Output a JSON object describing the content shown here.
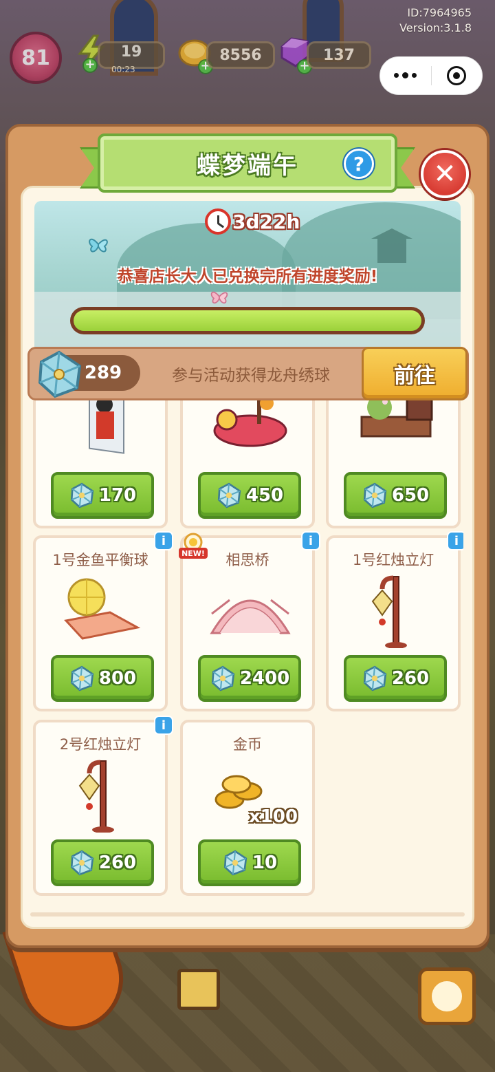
{
  "hud": {
    "user_id": "ID:7964965",
    "version": "Version:3.1.8",
    "level": "81",
    "energy": "19",
    "energy_timer": "00:23",
    "coins": "8556",
    "gems": "137"
  },
  "panel": {
    "title": "蝶梦端午",
    "help": "?",
    "close": "✕"
  },
  "banner": {
    "countdown": "3d22h",
    "message": "恭喜店长大人已兑换完所有进度奖励!",
    "progress": 1.0
  },
  "currency": {
    "count": "289",
    "hint": "参与活动获得龙舟绣球",
    "go_label": "前往"
  },
  "items": [
    {
      "name": "",
      "price": "170",
      "info": false,
      "new": false
    },
    {
      "name": "",
      "price": "450",
      "info": false,
      "new": false
    },
    {
      "name": "",
      "price": "650",
      "info": false,
      "new": false
    },
    {
      "name": "1号金鱼平衡球",
      "price": "800",
      "info": true,
      "new": false
    },
    {
      "name": "相思桥",
      "price": "2400",
      "info": true,
      "new": true
    },
    {
      "name": "1号红烛立灯",
      "price": "260",
      "info": true,
      "new": false
    },
    {
      "name": "2号红烛立灯",
      "price": "260",
      "info": true,
      "new": false
    },
    {
      "name": "金币",
      "price": "10",
      "info": false,
      "new": false,
      "quantity": "x100"
    }
  ],
  "badges": {
    "info": "i",
    "new": "NEW!"
  },
  "colors": {
    "panel": "#d69a63",
    "title_green": "#b5de72",
    "price_green": "#79bb2e",
    "go_yellow": "#efad2e",
    "close_red": "#d83c33"
  }
}
